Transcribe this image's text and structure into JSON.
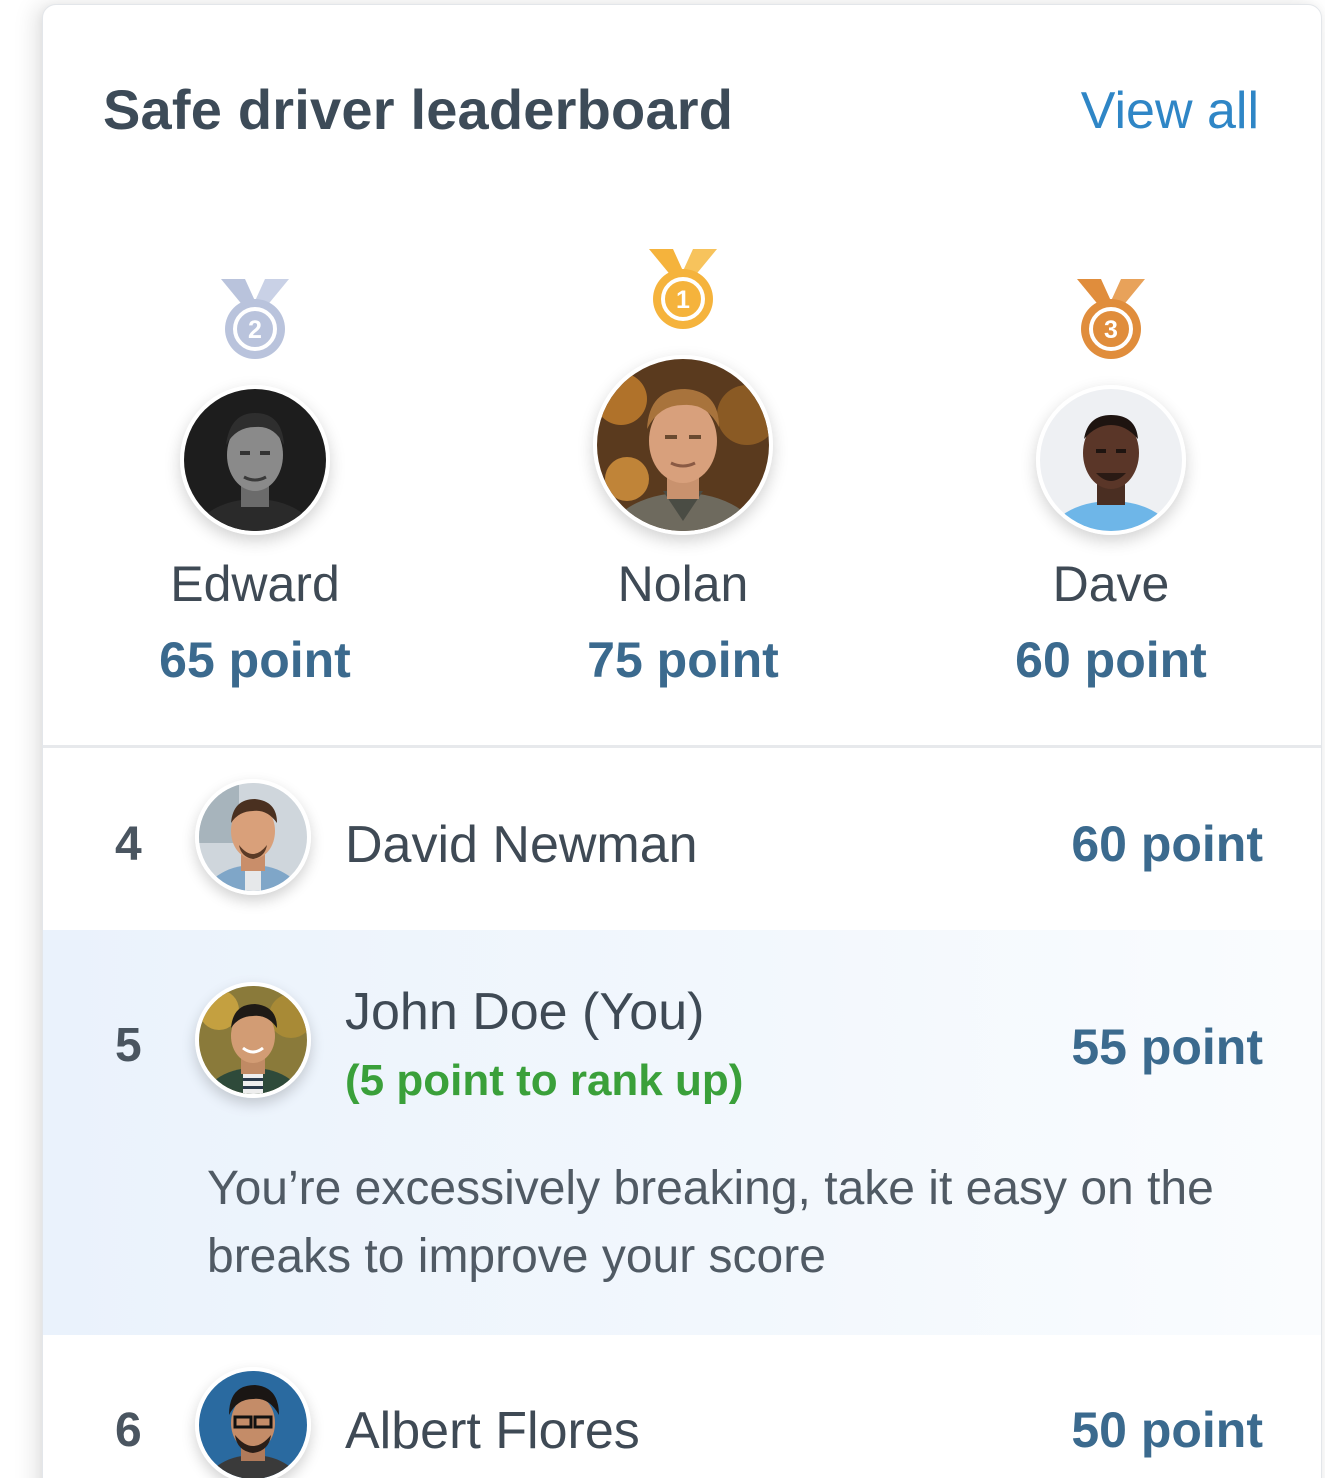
{
  "header": {
    "title": "Safe driver leaderboard",
    "view_all_label": "View all"
  },
  "podium": [
    {
      "rank": "2",
      "name": "Edward",
      "points": "65 point",
      "medal_color": "#b9c3dc"
    },
    {
      "rank": "1",
      "name": "Nolan",
      "points": "75 point",
      "medal_color": "#f5b33c"
    },
    {
      "rank": "3",
      "name": "Dave",
      "points": "60 point",
      "medal_color": "#e08d3c"
    }
  ],
  "list": [
    {
      "rank": "4",
      "name": "David Newman",
      "points": "60 point"
    },
    {
      "rank": "5",
      "name": "John Doe (You)",
      "points": "55 point",
      "rank_up": "(5 point to rank up)",
      "tip": "You’re excessively breaking, take it easy on the breaks to improve your score"
    },
    {
      "rank": "6",
      "name": "Albert Flores",
      "points": "50 point"
    }
  ],
  "colors": {
    "points_text": "#3b6a8e",
    "link": "#2f86c6",
    "rank_up": "#3aa03a",
    "highlight_bg": "#eaf2fc"
  }
}
